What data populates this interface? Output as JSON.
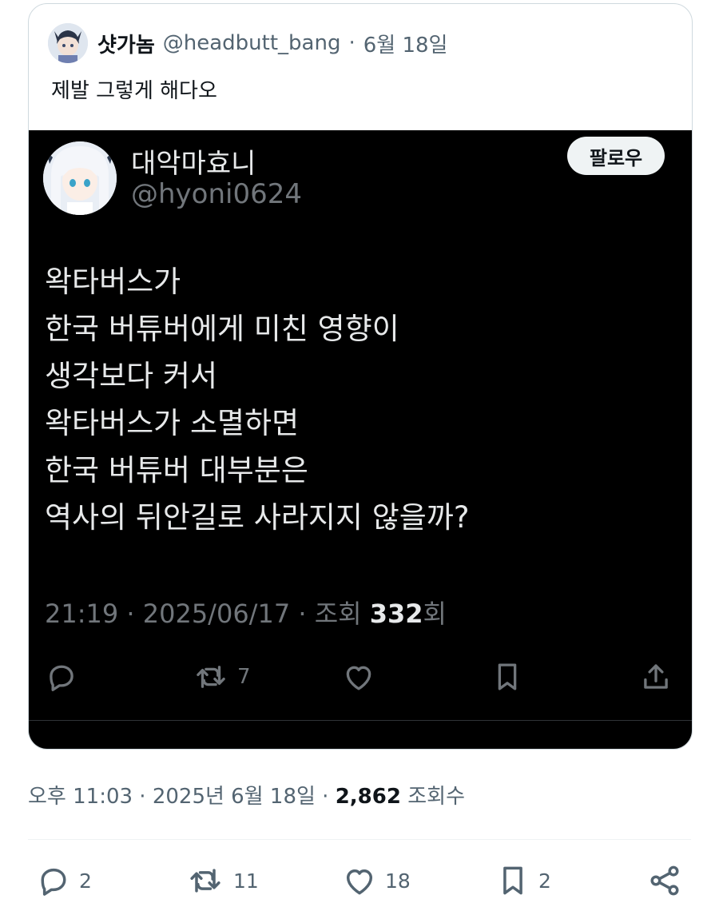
{
  "quote": {
    "display_name": "샷가놈",
    "handle": "@headbutt_bang",
    "separator": "·",
    "date": "6월 18일",
    "text": "제발 그렇게 해다오"
  },
  "screenshot": {
    "display_name": "대악마효니",
    "handle": "@hyoni0624",
    "follow_label": "팔로우",
    "body_lines": [
      "왁타버스가",
      "한국 버튜버에게 미친 영향이",
      "생각보다 커서",
      "왁타버스가 소멸하면",
      "한국 버튜버 대부분은",
      "역사의 뒤안길로 사라지지 않을까?"
    ],
    "meta_prefix": "21:19 · 2025/06/17 · 조회 ",
    "meta_views": "332",
    "meta_suffix": "회",
    "retweet_count": "7"
  },
  "tweet_meta": {
    "time_date": "오후 11:03 · 2025년 6월 18일 · ",
    "views": "2,862",
    "views_label": " 조회수"
  },
  "actions": {
    "reply_count": "2",
    "retweet_count": "11",
    "like_count": "18",
    "bookmark_count": "2"
  },
  "colors": {
    "text": "#0f1419",
    "secondary": "#536471",
    "dark_bg": "#000000",
    "dark_text": "#e7e9ea",
    "dark_secondary": "#71767b"
  }
}
